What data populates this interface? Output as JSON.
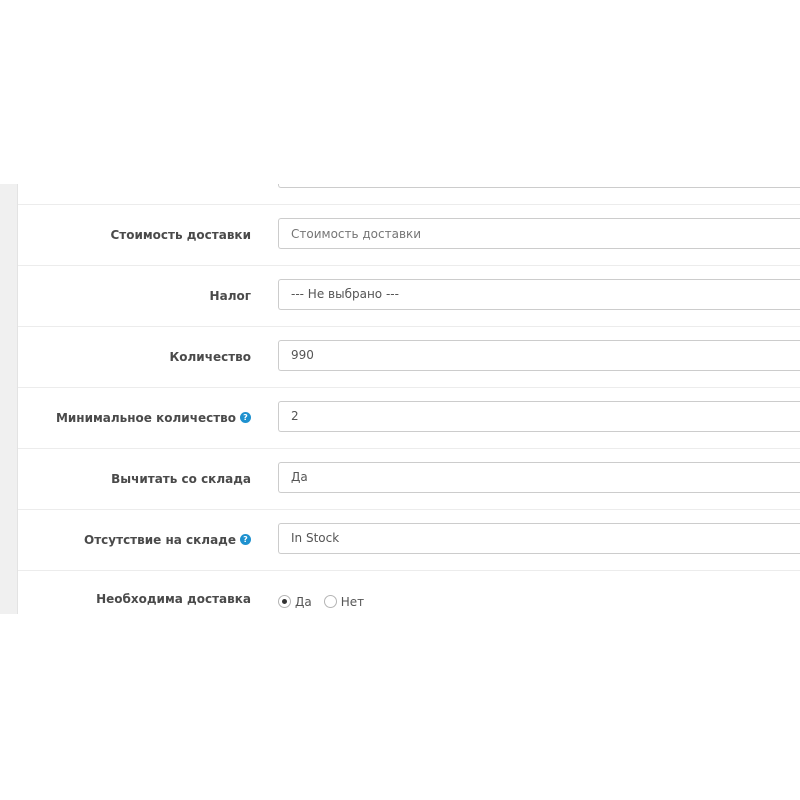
{
  "form": {
    "shipping_cost": {
      "label": "Стоимость доставки",
      "placeholder": "Стоимость доставки",
      "value": ""
    },
    "tax": {
      "label": "Налог",
      "value": "--- Не выбрано ---"
    },
    "quantity": {
      "label": "Количество",
      "value": "990"
    },
    "minimum_quantity": {
      "label": "Минимальное количество",
      "value": "2",
      "help_icon": "?"
    },
    "subtract_stock": {
      "label": "Вычитать со склада",
      "value": "Да"
    },
    "out_of_stock_status": {
      "label": "Отсутствие на складе",
      "value": "In Stock",
      "help_icon": "?"
    },
    "requires_shipping": {
      "label": "Необходима доставка",
      "options": [
        {
          "label": "Да",
          "checked": true
        },
        {
          "label": "Нет",
          "checked": false
        }
      ]
    }
  },
  "colors": {
    "help_icon": "#1e91cf",
    "label_text": "#4a4a4a",
    "field_border": "#cccccc"
  }
}
